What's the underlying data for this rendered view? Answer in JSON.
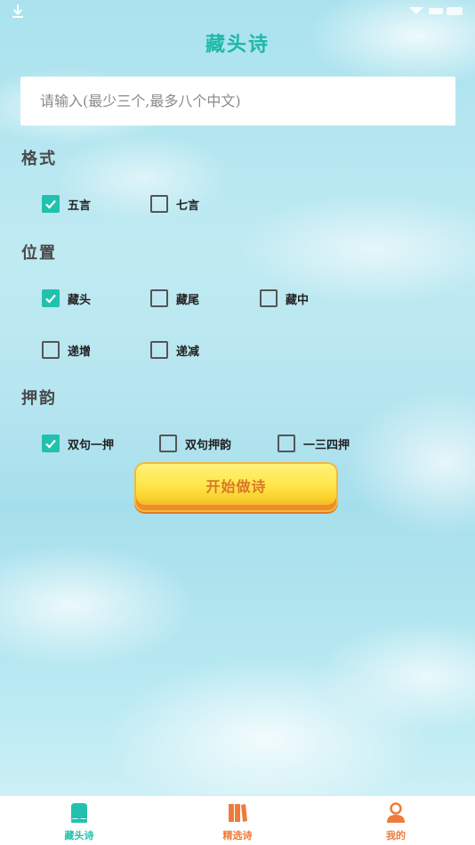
{
  "app": {
    "title": "藏头诗"
  },
  "input": {
    "placeholder": "请输入(最少三个,最多八个中文)"
  },
  "sections": {
    "format": {
      "label": "格式",
      "options": [
        {
          "label": "五言",
          "checked": true
        },
        {
          "label": "七言",
          "checked": false
        }
      ]
    },
    "position": {
      "label": "位置",
      "options": [
        {
          "label": "藏头",
          "checked": true
        },
        {
          "label": "藏尾",
          "checked": false
        },
        {
          "label": "藏中",
          "checked": false
        },
        {
          "label": "递增",
          "checked": false
        },
        {
          "label": "递减",
          "checked": false
        }
      ]
    },
    "rhyme": {
      "label": "押韵",
      "options": [
        {
          "label": "双句一押",
          "checked": true
        },
        {
          "label": "双句押韵",
          "checked": false
        },
        {
          "label": "一三四押",
          "checked": false
        }
      ]
    }
  },
  "start_button": {
    "label": "开始做诗"
  },
  "tabs": [
    {
      "label": "藏头诗",
      "icon": "poem-icon",
      "color": "#22c1ad",
      "active": true
    },
    {
      "label": "精选诗",
      "icon": "books-icon",
      "color": "#f07a3a",
      "active": false
    },
    {
      "label": "我的",
      "icon": "person-icon",
      "color": "#f07a3a",
      "active": false
    }
  ],
  "colors": {
    "accent": "#22c1ad",
    "button": "#ffe64a",
    "tab_inactive": "#f07a3a"
  }
}
